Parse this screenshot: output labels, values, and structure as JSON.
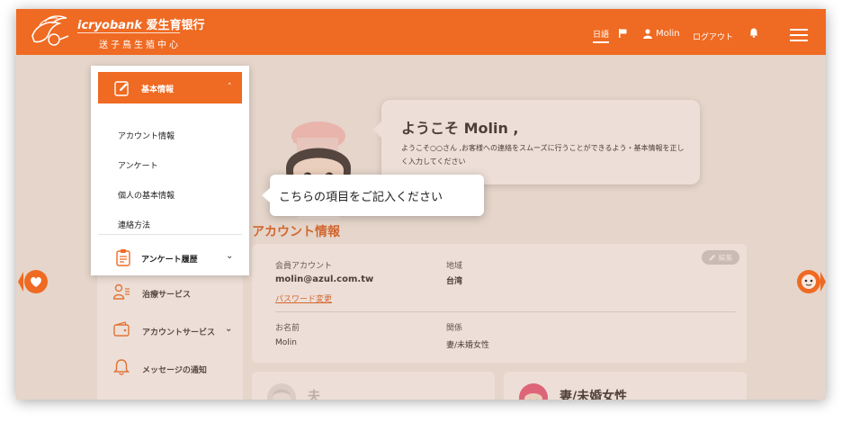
{
  "header": {
    "logo_brand": "icryobank",
    "logo_chinese": "爱生育银行",
    "logo_subtitle": "送子鳥生殖中心",
    "lang": "日語",
    "user": "Molin",
    "logout": "ログアウト"
  },
  "sidebar": {
    "active_menu": "基本情報",
    "sub_items": [
      "アカウント情報",
      "アンケート",
      "個人の基本情報",
      "連絡方法"
    ],
    "survey_history": "アンケート履歴",
    "other_items": [
      "治療サービス",
      "アカウントサービス",
      "メッセージの通知"
    ]
  },
  "welcome": {
    "title": "ようこそ Molin ,",
    "text": "ようこそ○○さん ,お客様への連絡をスムーズに行うことができるよう・基本情報を正しく入力してください"
  },
  "tooltip": {
    "text": "こちらの項目をご記入ください"
  },
  "account": {
    "section_title": "アカウント情報",
    "edit": "編集",
    "member_account_label": "会員アカウント",
    "member_account_value": "molin@azul.com.tw",
    "password_link": "パスワード変更",
    "region_label": "地域",
    "region_value": "台湾",
    "name_label": "お名前",
    "name_value": "Molin",
    "relation_label": "関係",
    "relation_value": "妻/未婚女性"
  },
  "profiles": {
    "husband": "夫",
    "wife": "妻/未婚女性"
  },
  "colors": {
    "brand": "#ef6a22",
    "accent_text": "#d85a1a"
  }
}
